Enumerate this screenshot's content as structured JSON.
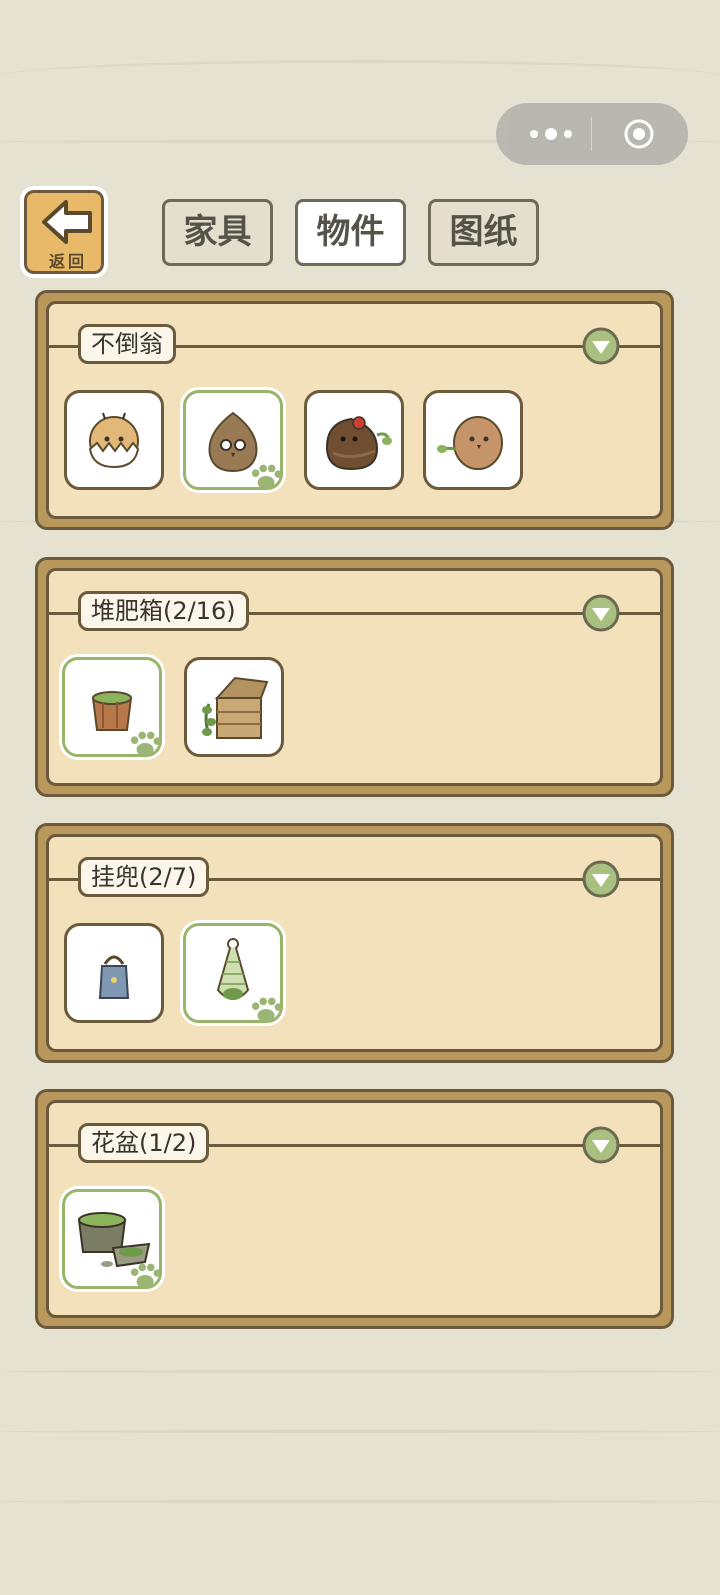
{
  "capsule": {
    "more_icon": "more-dots-icon",
    "close_icon": "target-circle-icon"
  },
  "back": {
    "label": "返回",
    "icon": "left-arrow-icon"
  },
  "tabs": [
    {
      "label": "家具",
      "active": false
    },
    {
      "label": "物件",
      "active": true
    },
    {
      "label": "图纸",
      "active": false
    }
  ],
  "sections": [
    {
      "title": "不倒翁",
      "items": [
        "egg-chick",
        "brown-bean",
        "red-flower-bean",
        "leaf-bean"
      ],
      "owned": [
        false,
        true,
        false,
        false
      ]
    },
    {
      "title": "堆肥箱(2/16)",
      "items": [
        "wood-bucket",
        "compost-crate"
      ],
      "owned": [
        true,
        false
      ]
    },
    {
      "title": "挂兜(2/7)",
      "items": [
        "blue-bag",
        "net-bag"
      ],
      "owned": [
        false,
        true
      ]
    },
    {
      "title": "花盆(1/2)",
      "items": [
        "moss-stump-pot"
      ],
      "owned": [
        true
      ]
    }
  ],
  "colors": {
    "owned_border": "#98b56b",
    "frame": "#6b5a3b",
    "panel_fill": "#f2e1bb",
    "accent_green": "#9bb574"
  }
}
